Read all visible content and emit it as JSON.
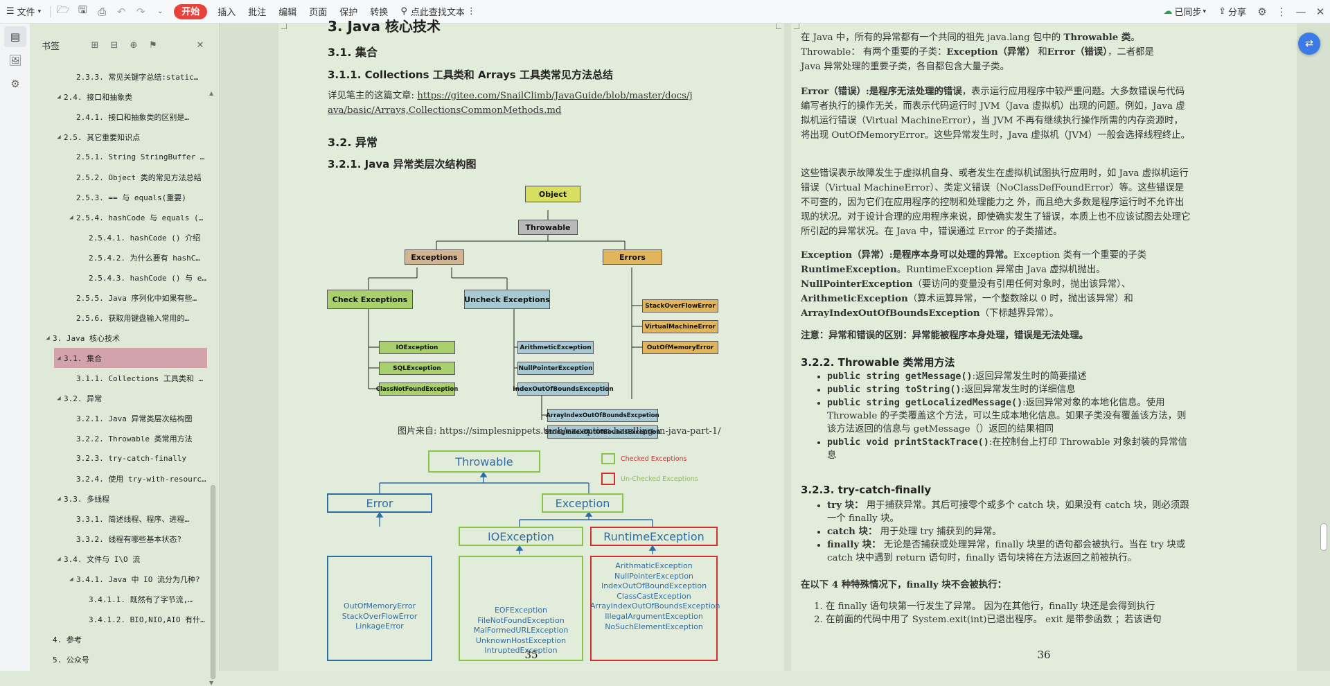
{
  "toolbar": {
    "file_label": "文件",
    "menu": [
      "插入",
      "批注",
      "编辑",
      "页面",
      "保护",
      "转换"
    ],
    "start_label": "开始",
    "search_label": "点此查找文本",
    "sync_label": "已同步",
    "share_label": "分享"
  },
  "bookmark_panel": {
    "title": "书签",
    "items": [
      {
        "text": "2.3.3. 常见关键字总结:static…",
        "indent": 2,
        "arrow": ""
      },
      {
        "text": "2.4. 接口和抽象类",
        "indent": 1,
        "arrow": "◢"
      },
      {
        "text": "2.4.1. 接口和抽象类的区别是…",
        "indent": 2,
        "arrow": ""
      },
      {
        "text": "2.5. 其它重要知识点",
        "indent": 1,
        "arrow": "◢"
      },
      {
        "text": "2.5.1. String StringBuffer …",
        "indent": 2,
        "arrow": ""
      },
      {
        "text": "2.5.2. Object 类的常见方法总结",
        "indent": 2,
        "arrow": ""
      },
      {
        "text": "2.5.3. == 与 equals(重要)",
        "indent": 2,
        "arrow": ""
      },
      {
        "text": "2.5.4. hashCode 与 equals (…",
        "indent": 2,
        "arrow": "◢"
      },
      {
        "text": "2.5.4.1. hashCode () 介绍",
        "indent": 3,
        "arrow": ""
      },
      {
        "text": "2.5.4.2. 为什么要有 hashC…",
        "indent": 3,
        "arrow": ""
      },
      {
        "text": "2.5.4.3. hashCode () 与 e…",
        "indent": 3,
        "arrow": ""
      },
      {
        "text": "2.5.5. Java 序列化中如果有些…",
        "indent": 2,
        "arrow": ""
      },
      {
        "text": "2.5.6. 获取用键盘输入常用的…",
        "indent": 2,
        "arrow": ""
      },
      {
        "text": "3. Java 核心技术",
        "indent": 0,
        "arrow": "◢"
      },
      {
        "text": "3.1. 集合",
        "indent": 1,
        "arrow": "◢",
        "selected": true
      },
      {
        "text": "3.1.1. Collections 工具类和 …",
        "indent": 2,
        "arrow": ""
      },
      {
        "text": "3.2. 异常",
        "indent": 1,
        "arrow": "◢"
      },
      {
        "text": "3.2.1. Java 异常类层次结构图",
        "indent": 2,
        "arrow": ""
      },
      {
        "text": "3.2.2. Throwable 类常用方法",
        "indent": 2,
        "arrow": ""
      },
      {
        "text": "3.2.3. try-catch-finally",
        "indent": 2,
        "arrow": ""
      },
      {
        "text": "3.2.4. 使用 try-with-resourc…",
        "indent": 2,
        "arrow": ""
      },
      {
        "text": "3.3. 多线程",
        "indent": 1,
        "arrow": "◢"
      },
      {
        "text": "3.3.1. 简述线程、程序、进程…",
        "indent": 2,
        "arrow": ""
      },
      {
        "text": "3.3.2. 线程有哪些基本状态?",
        "indent": 2,
        "arrow": ""
      },
      {
        "text": "3.4. 文件与 I\\O 流",
        "indent": 1,
        "arrow": "◢"
      },
      {
        "text": "3.4.1. Java 中 IO 流分为几种?",
        "indent": 2,
        "arrow": "◢"
      },
      {
        "text": "3.4.1.1. 既然有了字节流,…",
        "indent": 3,
        "arrow": ""
      },
      {
        "text": "3.4.1.2. BIO,NIO,AIO 有什…",
        "indent": 3,
        "arrow": ""
      },
      {
        "text": "4. 参考",
        "indent": 0,
        "arrow": ""
      },
      {
        "text": "5. 公众号",
        "indent": 0,
        "arrow": ""
      }
    ]
  },
  "page35": {
    "top_title": "3. Java 核心技术",
    "h_31": "3.1. 集合",
    "h_311": "3.1.1. Collections 工具类和 Arrays 工具类常见方法总结",
    "p_prefix": "详见笔主的这篇文章: ",
    "p_link1": "https://gitee.com/SnailClimb/JavaGuide/blob/master/docs/j",
    "p_link2": "ava/basic/Arrays,CollectionsCommonMethods.md",
    "h_32": "3.2. 异常",
    "h_321": "3.2.1. Java 异常类层次结构图",
    "diagram1": {
      "object": "Object",
      "throwable": "Throwable",
      "exceptions": "Exceptions",
      "errors": "Errors",
      "check": "Check Exceptions",
      "uncheck": "Uncheck Exceptions",
      "check_items": [
        "IOException",
        "SQLException",
        "ClassNotFoundException"
      ],
      "uncheck_items": [
        "ArithmeticException",
        "NullPointerException",
        "IndexOutOfBoundsException"
      ],
      "index_items": [
        "ArrayIndexOutOfBoundsExcpetion",
        "StringIndexOutOfBoundsException"
      ],
      "error_items": [
        "StackOverFlowError",
        "VirtualMachineError",
        "OutOfMemoryError"
      ]
    },
    "caption": "图片来自: https://simplesnippets.tech/exception-handling-in-java-part-1/",
    "diagram2": {
      "throwable": "Throwable",
      "legend_checked": "Checked Exceptions",
      "legend_unchecked": "Un-Checked Exceptions",
      "error": "Error",
      "exception": "Exception",
      "ioexception": "IOException",
      "runtime": "RuntimeException",
      "error_list": [
        "OutOfMemoryError",
        "StackOverFlowError",
        "LinkageError"
      ],
      "io_list": [
        "EOFException",
        "FileNotFoundException",
        "MalFormedURLException",
        "UnknownHostException",
        "IntruptedException"
      ],
      "runtime_list": [
        "ArithmaticException",
        "NullPointerException",
        "IndexOutOfBoundException",
        "ClassCastException",
        "ArrayIndexOutOfBoundsException",
        "IllegalArgumentException",
        "NoSuchElementException"
      ],
      "colors": {
        "blue": "#2e6da4",
        "green": "#8bc34a",
        "red": "#d32f2f"
      }
    },
    "page_number": "35"
  },
  "page36": {
    "p1_a": "在 Java 中，所有的异常都有一个共同的祖先 java.lang 包中的 ",
    "p1_b": "Throwable 类",
    "p1_c": "。",
    "p1_d": "Throwable： 有两个重要的子类：",
    "p1_e": "Exception（异常）",
    "p1_f": " 和",
    "p1_g": "Error（错误）",
    "p1_h": "，二者都是",
    "p1_i": "Java 异常处理的重要子类，各自都包含大量子类。",
    "p2_bold": "Error（错误）:是程序无法处理的错误",
    "p2_rest": "，表示运行应用程序中较严重问题。大多数错误与代码编写者执行的操作无关，而表示代码运行时 JVM（Java 虚拟机）出现的问题。例如，Java 虚拟机运行错误（Virtual MachineError），当 JVM 不再有继续执行操作所需的内存资源时，将出现 OutOfMemoryError。这些异常发生时，Java 虚拟机（JVM）一般会选择线程终止。",
    "p3": "这些错误表示故障发生于虚拟机自身、或者发生在虚拟机试图执行应用时，如 Java 虚拟机运行错误（Virtual MachineError）、类定义错误（NoClassDefFoundError）等。这些错误是不可查的，因为它们在应用程序的控制和处理能力之 外，而且绝大多数是程序运行时不允许出现的状况。对于设计合理的应用程序来说，即使确实发生了错误，本质上也不应该试图去处理它所引起的异常状况。在 Java 中，错误通过 Error 的子类描述。",
    "p4_bold": "Exception（异常）:是程序本身可以处理的异常。",
    "p4_a": "Exception 类有一个重要的子类 ",
    "p4_b": "RuntimeException",
    "p4_c": "。RuntimeException 异常由 Java 虚拟机抛出。",
    "p4_d": "NullPointerException",
    "p4_e": "（要访问的变量没有引用任何对象时，抛出该异常）、",
    "p4_f": "ArithmeticException",
    "p4_g": "（算术运算异常，一个整数除以 0 时，抛出该异常）和 ",
    "p4_h": "ArrayIndexOutOfBoundsException",
    "p4_i": "（下标越界异常）。",
    "p5": "注意：异常和错误的区别：异常能被程序本身处理，错误是无法处理。",
    "h_322": "3.2.2. Throwable 类常用方法",
    "methods": [
      {
        "code": "public string getMessage()",
        "desc": ":返回异常发生时的简要描述"
      },
      {
        "code": "public string toString()",
        "desc": ":返回异常发生时的详细信息"
      },
      {
        "code": "public string getLocalizedMessage()",
        "desc": ":返回异常对象的本地化信息。使用 Throwable 的子类覆盖这个方法，可以生成本地化信息。如果子类没有覆盖该方法，则该方法返回的信息与 getMessage（）返回的结果相同"
      },
      {
        "code": "public void printStackTrace()",
        "desc": ":在控制台上打印 Throwable 对象封装的异常信息"
      }
    ],
    "h_323": "3.2.3. try-catch-finally",
    "blocks": [
      {
        "name": "try 块：",
        "desc": " 用于捕获异常。其后可接零个或多个 catch 块，如果没有 catch 块，则必须跟一个 finally 块。"
      },
      {
        "name": "catch 块：",
        "desc": " 用于处理 try 捕获到的异常。"
      },
      {
        "name": "finally 块：",
        "desc": " 无论是否捕获或处理异常，finally 块里的语句都会被执行。当在 try 块或 catch 块中遇到 return 语句时，finally 语句块将在方法返回之前被执行。"
      }
    ],
    "p6": "在以下 4 种特殊情况下，finally 块不会被执行：",
    "cases": [
      "在 finally 语句块第一行发生了异常。 因为在其他行，finally 块还是会得到执行",
      "在前面的代码中用了 System.exit(int)已退出程序。 exit 是带参函数 ；若该语句"
    ],
    "page_number": "36"
  }
}
